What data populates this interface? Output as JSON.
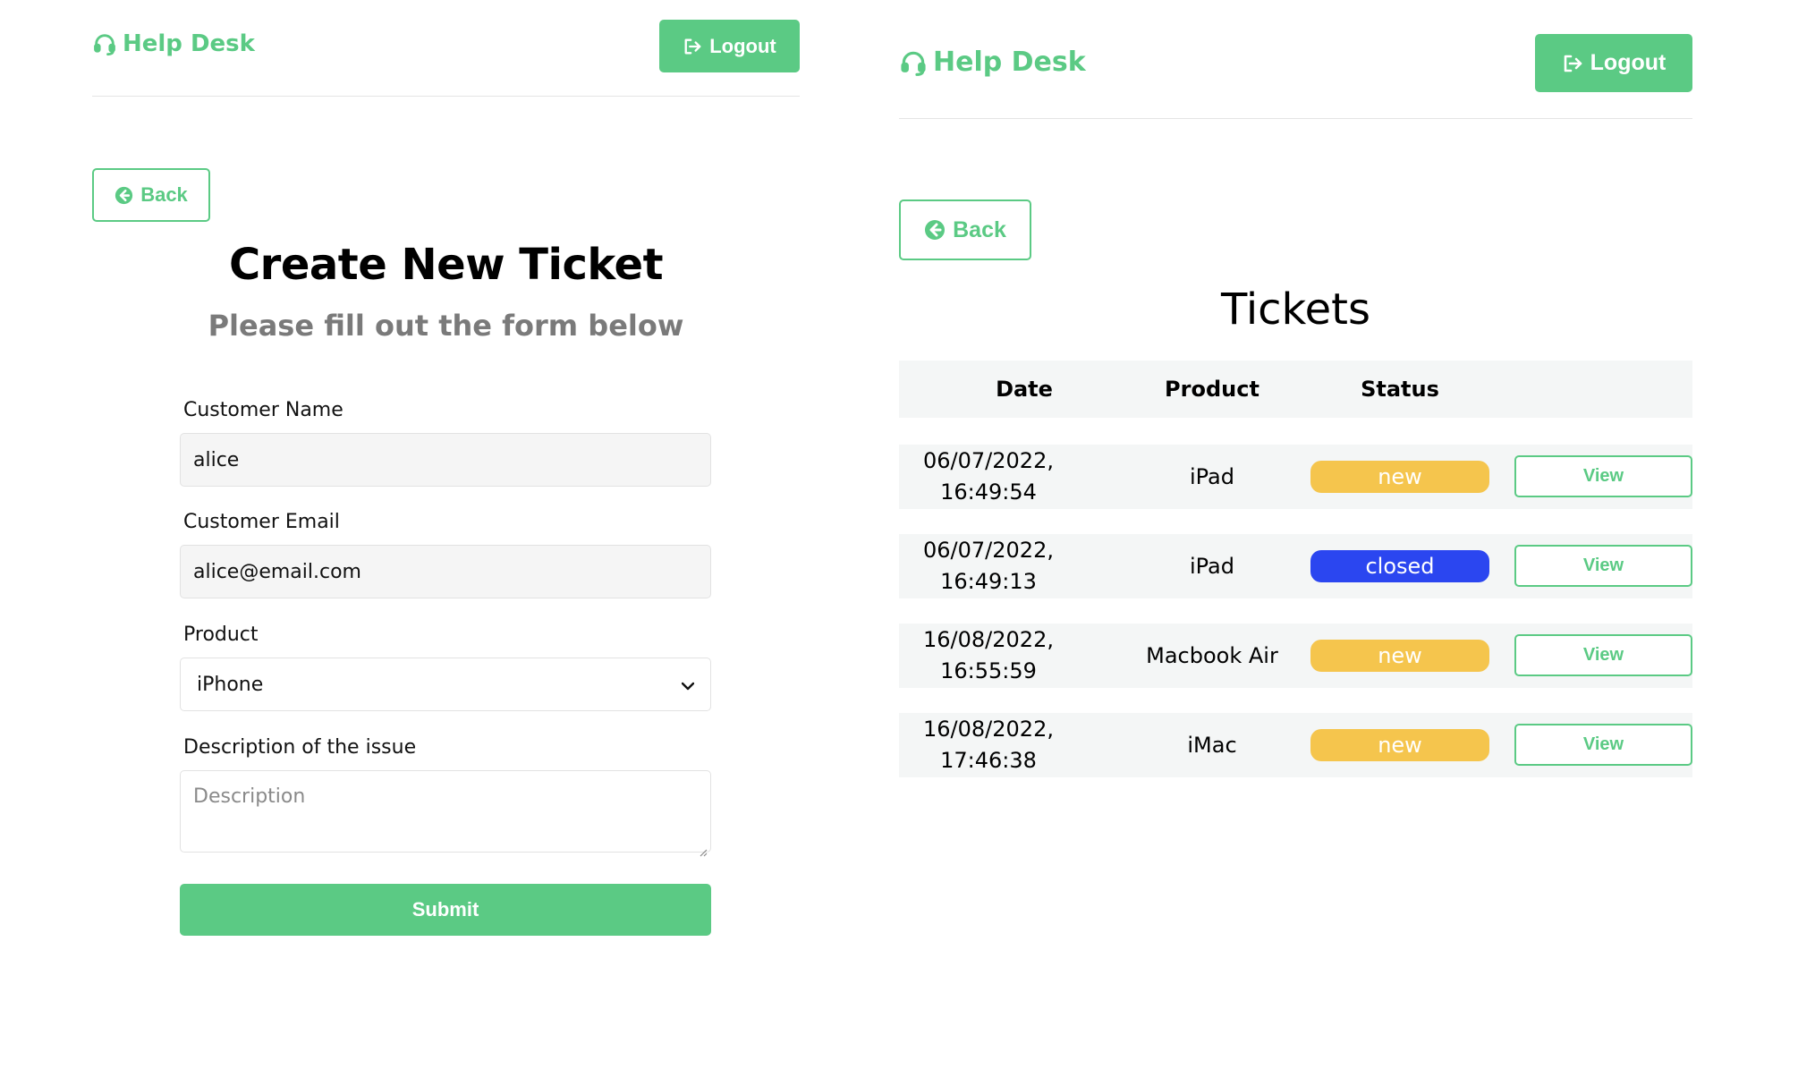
{
  "left": {
    "brand": "Help Desk",
    "logout_label": "Logout",
    "back_label": "Back",
    "title": "Create New Ticket",
    "subtitle": "Please fill out the form below",
    "fields": {
      "name_label": "Customer Name",
      "name_value": "alice",
      "email_label": "Customer Email",
      "email_value": "alice@email.com",
      "product_label": "Product",
      "product_value": "iPhone",
      "description_label": "Description of the issue",
      "description_placeholder": "Description"
    },
    "submit_label": "Submit"
  },
  "right": {
    "brand": "Help Desk",
    "logout_label": "Logout",
    "back_label": "Back",
    "title": "Tickets",
    "columns": [
      "Date",
      "Product",
      "Status"
    ],
    "rows": [
      {
        "date": "06/07/2022,",
        "time": "16:49:54",
        "product": "iPad",
        "status": "new",
        "action": "View"
      },
      {
        "date": "06/07/2022,",
        "time": "16:49:13",
        "product": "iPad",
        "status": "closed",
        "action": "View"
      },
      {
        "date": "16/08/2022,",
        "time": "16:55:59",
        "product": "Macbook Air",
        "status": "new",
        "action": "View"
      },
      {
        "date": "16/08/2022,",
        "time": "17:46:38",
        "product": "iMac",
        "status": "new",
        "action": "View"
      }
    ]
  },
  "colors": {
    "accent": "#5bca84",
    "status_new": "#f5c54d",
    "status_closed": "#2b46f0",
    "subtitle_gray": "#7a7a7a"
  },
  "icons": {
    "brand": "headset-icon",
    "logout": "sign-out-icon",
    "back": "arrow-circle-left-icon",
    "select": "chevron-down-icon"
  }
}
